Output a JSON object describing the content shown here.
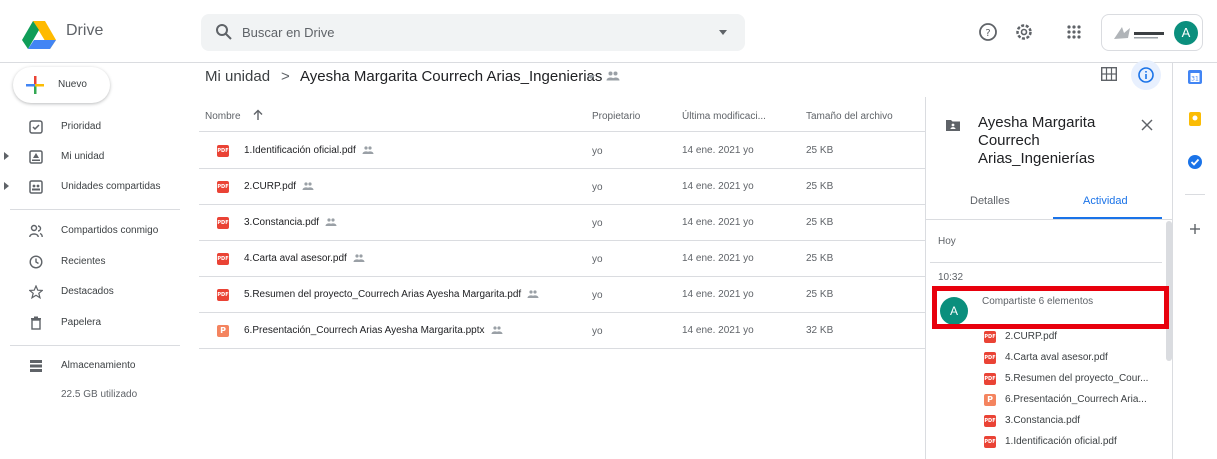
{
  "app": {
    "name": "Drive"
  },
  "search": {
    "placeholder": "Buscar en Drive"
  },
  "sidebar": {
    "new_label": "Nuevo",
    "items": [
      {
        "label": "Prioridad",
        "icon": "priority-icon"
      },
      {
        "label": "Mi unidad",
        "icon": "my-drive-icon"
      },
      {
        "label": "Unidades compartidas",
        "icon": "shared-drives-icon"
      },
      {
        "label": "Compartidos conmigo",
        "icon": "shared-with-me-icon"
      },
      {
        "label": "Recientes",
        "icon": "clock-icon"
      },
      {
        "label": "Destacados",
        "icon": "star-icon"
      },
      {
        "label": "Papelera",
        "icon": "trash-icon"
      },
      {
        "label": "Almacenamiento",
        "icon": "storage-icon"
      }
    ],
    "storage_used": "22.5 GB utilizado"
  },
  "breadcrumb": {
    "root": "Mi unidad",
    "separator": ">",
    "current": "Ayesha Margarita Courrech Arias_Ingenierias"
  },
  "table": {
    "headers": {
      "name": "Nombre",
      "owner": "Propietario",
      "modified": "Última modificaci...",
      "size": "Tamaño del archivo"
    },
    "rows": [
      {
        "name": "1.Identificación oficial.pdf",
        "type": "pdf",
        "owner": "yo",
        "modified": "14 ene. 2021 yo",
        "size": "25 KB"
      },
      {
        "name": "2.CURP.pdf",
        "type": "pdf",
        "owner": "yo",
        "modified": "14 ene. 2021 yo",
        "size": "25 KB"
      },
      {
        "name": "3.Constancia.pdf",
        "type": "pdf",
        "owner": "yo",
        "modified": "14 ene. 2021 yo",
        "size": "25 KB"
      },
      {
        "name": "4.Carta aval asesor.pdf",
        "type": "pdf",
        "owner": "yo",
        "modified": "14 ene. 2021 yo",
        "size": "25 KB"
      },
      {
        "name": "5.Resumen del proyecto_Courrech Arias Ayesha Margarita.pdf",
        "type": "pdf",
        "owner": "yo",
        "modified": "14 ene. 2021 yo",
        "size": "25 KB"
      },
      {
        "name": "6.Presentación_Courrech Arias Ayesha Margarita.pptx",
        "type": "pptx",
        "owner": "yo",
        "modified": "14 ene. 2021 yo",
        "size": "32 KB"
      }
    ]
  },
  "details_panel": {
    "title": "Ayesha Margarita Courrech Arias_Ingenierías",
    "tabs": {
      "details": "Detalles",
      "activity": "Actividad"
    },
    "active_tab": "activity",
    "day_label": "Hoy",
    "time_label": "10:32",
    "avatar_letter": "A",
    "activity_text": "Compartiste 6 elementos",
    "activity_files": [
      {
        "name": "2.CURP.pdf",
        "type": "pdf"
      },
      {
        "name": "4.Carta aval asesor.pdf",
        "type": "pdf"
      },
      {
        "name": "5.Resumen del proyecto_Cour...",
        "type": "pdf"
      },
      {
        "name": "6.Presentación_Courrech Aria...",
        "type": "pptx"
      },
      {
        "name": "3.Constancia.pdf",
        "type": "pdf"
      },
      {
        "name": "1.Identificación oficial.pdf",
        "type": "pdf"
      }
    ]
  },
  "account": {
    "avatar_letter": "A"
  },
  "icon_badges": {
    "pdf": "PDF",
    "pptx": "P"
  },
  "colors": {
    "pdf_red": "#ea4335",
    "pptx_orange": "#f4845f",
    "accent_blue": "#1a73e8",
    "avatar_teal": "#0b8f7d",
    "highlight_red": "#e8000d"
  }
}
